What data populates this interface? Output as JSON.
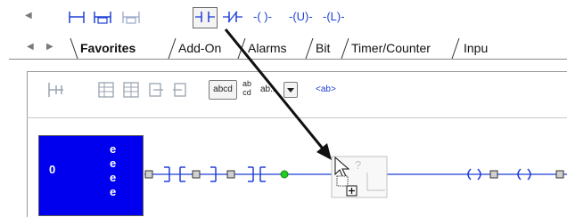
{
  "instruction_toolbar": {
    "items": [
      {
        "name": "scroll-left",
        "glyph": "◀"
      },
      {
        "name": "branch",
        "glyph": ""
      },
      {
        "name": "branch-level",
        "glyph": ""
      },
      {
        "name": "empty-rung",
        "glyph": ""
      },
      {
        "name": "xic",
        "glyph": ""
      },
      {
        "name": "xio",
        "glyph": ""
      },
      {
        "name": "ote",
        "label": "-( )-"
      },
      {
        "name": "otu",
        "label": "-(U)-"
      },
      {
        "name": "otl",
        "label": "-(L)-"
      }
    ]
  },
  "tabs": {
    "scroll_left": "◀",
    "scroll_right": "▶",
    "items": [
      "Favorites",
      "Add-On",
      "Alarms",
      "Bit",
      "Timer/Counter",
      "Inpu"
    ],
    "active": "Favorites"
  },
  "editor_toolbar": {
    "abcd_label": "abcd",
    "ab_label": "ab",
    "cd_label": "cd",
    "ab_dropdown_label": "ab...",
    "ab_tag_label": "<ab>"
  },
  "rung": {
    "number": "0",
    "e_letters": [
      "e",
      "e",
      "e",
      "e"
    ],
    "drop_marker": "?"
  },
  "colors": {
    "rung_highlight": "#0000ee",
    "instruction_blue": "#1f3fd6",
    "node_green": "#22cc22"
  }
}
